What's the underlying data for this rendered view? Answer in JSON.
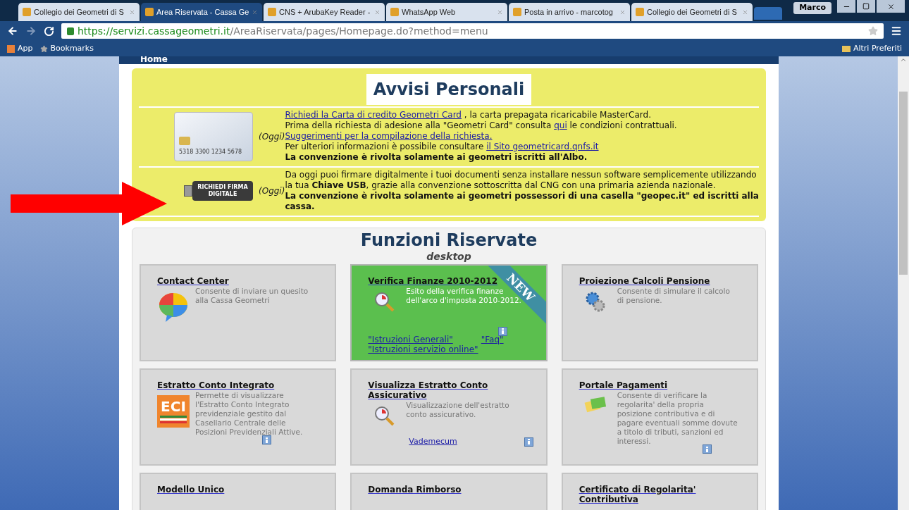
{
  "browser": {
    "tabs": [
      {
        "label": "Collegio dei Geometri di S",
        "selected": false
      },
      {
        "label": "Area Riservata - Cassa Ge",
        "selected": true
      },
      {
        "label": "CNS + ArubaKey Reader -",
        "selected": false
      },
      {
        "label": "WhatsApp Web",
        "selected": false
      },
      {
        "label": "Posta in arrivo - marcotog",
        "selected": false
      },
      {
        "label": "Collegio dei Geometri di S",
        "selected": false
      }
    ],
    "user": "Marco",
    "url_host": "https://servizi.cassageometri.it",
    "url_path": "/AreaRiservata/pages/Homepage.do?method=menu",
    "bookmarks": [
      "App",
      "Bookmarks"
    ],
    "other_bookmarks": "Altri Preferiti"
  },
  "nav": {
    "breadcrumb": "Home"
  },
  "notices": {
    "title": "Avvisi Personali",
    "items": [
      {
        "kind": "card",
        "image_text": "5318 3300 1234 5678",
        "date": "(Oggi)",
        "lines": [
          [
            {
              "text": "Richiedi la Carta di credito Geometri Card",
              "link": true
            },
            {
              "text": " , la carta prepagata ricaricabile MasterCard.",
              "link": false
            }
          ],
          [
            {
              "text": "Prima della richiesta di adesione alla \"Geometri Card\" consulta ",
              "link": false
            },
            {
              "text": "qui",
              "link": true
            },
            {
              "text": " le condizioni contrattuali.",
              "link": false
            }
          ],
          [
            {
              "text": "Suggerimenti per la compilazione della richiesta.",
              "link": true
            }
          ],
          [
            {
              "text": "Per ulteriori informazioni è possibile consultare ",
              "link": false
            },
            {
              "text": "il Sito geometricard.qnfs.it",
              "link": true
            }
          ]
        ],
        "emphasis": "La convenzione è rivolta solamente ai geometri iscritti all'Albo."
      },
      {
        "kind": "usb",
        "image_text": "RICHIEDI FIRMA DIGITALE",
        "date": "(Oggi)",
        "lines": [
          [
            {
              "text": "Da oggi puoi firmare digitalmente i tuoi documenti senza installare nessun software semplicemente utilizzando la tua **Chiave USB**, grazie alla convenzione sottoscritta dal CNG con una primaria azienda nazionale.",
              "link": false
            }
          ]
        ],
        "emphasis": "La convenzione è rivolta solamente ai geometri possessori di una casella \"geopec.it\" ed iscritti alla cassa."
      }
    ]
  },
  "functions": {
    "title": "Funzioni Riservate",
    "subtitle": "desktop",
    "tiles": [
      {
        "title": "Contact Center",
        "kind": "chat",
        "description": "Consente di inviare un quesito alla Cassa Geometri",
        "featured": false,
        "info": false
      },
      {
        "title": "Verifica Finanze 2010-2012",
        "kind": "search",
        "description": "Esito della verifica finanze dell'arco d'imposta 2010-2012.",
        "featured": true,
        "ribbon": "NEW",
        "info": true,
        "links": [
          "\"Istruzioni Generali\"",
          "\"Faq\"",
          "\"Istruzioni servizio online\""
        ]
      },
      {
        "title": "Proiezione Calcoli Pensione",
        "kind": "gears",
        "description": "Consente di simulare il calcolo di pensione.",
        "featured": false,
        "info": false
      },
      {
        "title": "Estratto Conto Integrato",
        "kind": "eci",
        "icon_text": "ECI",
        "description": "Permette di visualizzare l'Estratto Conto Integrato previdenziale gestito dal Casellario Centrale delle Posizioni Previdenziali Attive.",
        "featured": false,
        "info": true
      },
      {
        "title": "Visualizza Estratto Conto Assicurativo",
        "kind": "search",
        "description": "Visualizzazione dell'estratto conto assicurativo.",
        "featured": false,
        "info": true,
        "links": [
          "Vademecum"
        ]
      },
      {
        "title": "Portale Pagamenti",
        "kind": "cards",
        "description": "Consente di verificare la regolarita' della propria posizione contributiva e di pagare eventuali somme dovute a titolo di tributi, sanzioni ed interessi.",
        "featured": false,
        "info": true
      },
      {
        "title": "Modello Unico",
        "featured": false,
        "info": false
      },
      {
        "title": "Domanda Rimborso",
        "featured": false,
        "info": false
      },
      {
        "title": "Certificato di Regolarita' Contributiva",
        "featured": false,
        "info": false
      }
    ]
  }
}
